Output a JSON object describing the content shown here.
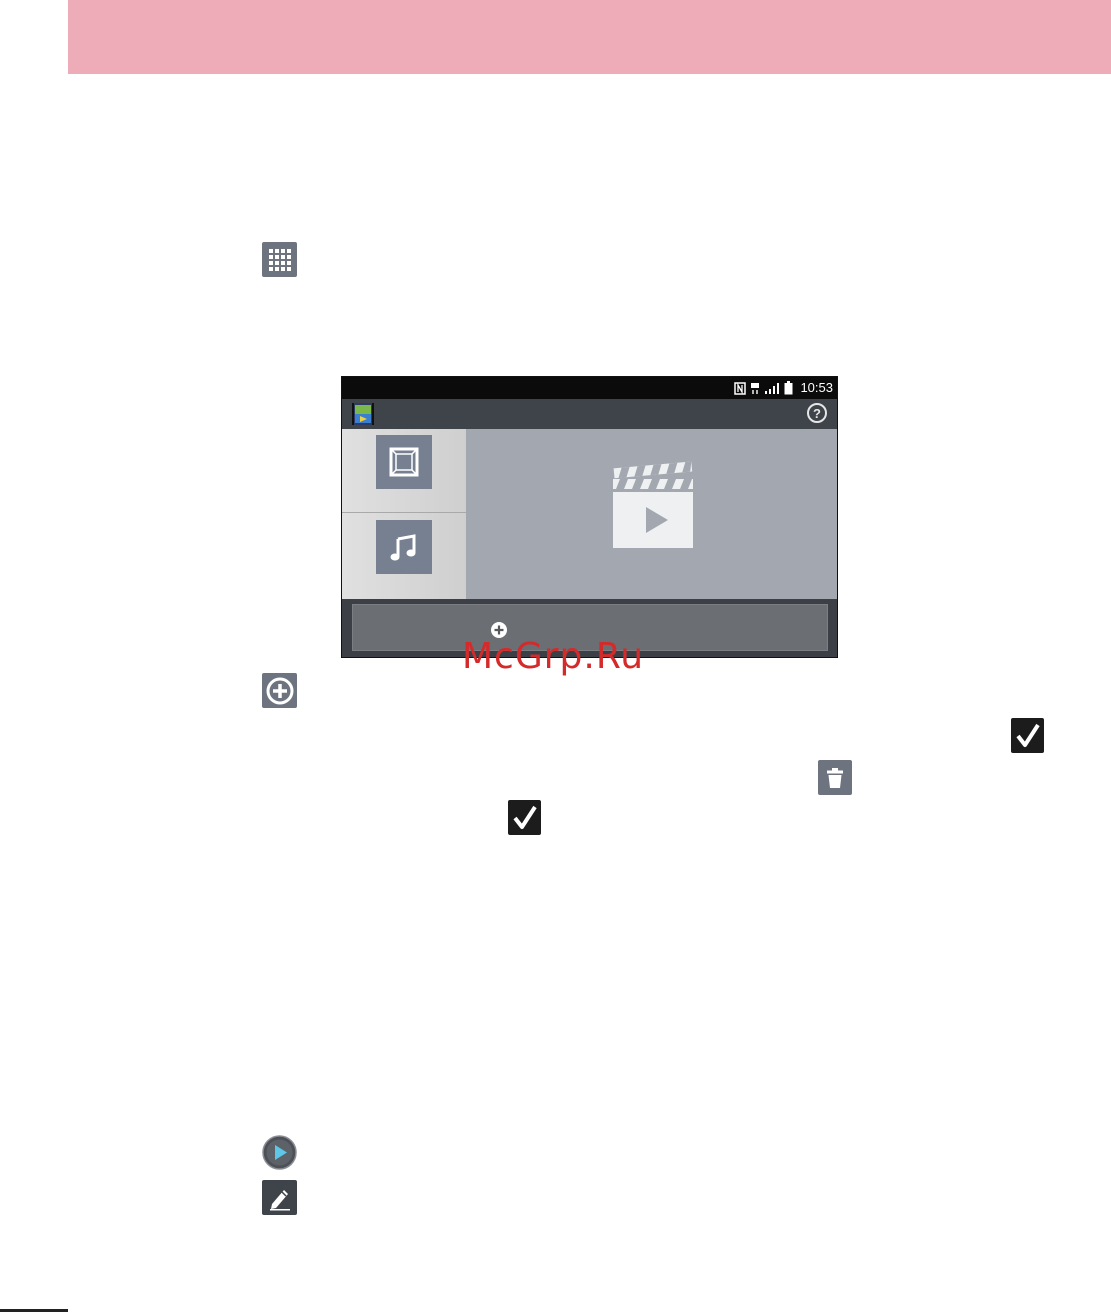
{
  "phone": {
    "status_time": "10:53"
  },
  "watermark": "McGrp.Ru",
  "icons": {
    "apps": "apps-grid-icon",
    "add": "add-circle-icon",
    "check": "check-icon",
    "delete": "trash-icon",
    "play": "play-icon",
    "edit": "pencil-icon",
    "help": "?"
  },
  "colors": {
    "header_band": "#eeabb8",
    "watermark": "#d42a2a"
  }
}
